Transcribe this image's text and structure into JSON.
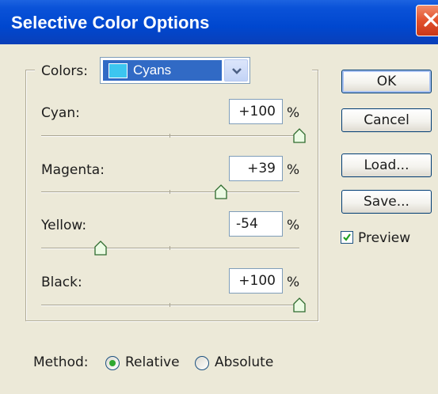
{
  "dialog": {
    "title": "Selective Color Options"
  },
  "colors": {
    "label": "Colors:",
    "selected": "Cyans",
    "swatch_color": "#3cc6f0"
  },
  "channels": [
    {
      "label": "Cyan:",
      "value": "+100",
      "unit": "%",
      "slider_fraction": 1.0
    },
    {
      "label": "Magenta:",
      "value": "+39",
      "unit": "%",
      "slider_fraction": 0.695
    },
    {
      "label": "Yellow:",
      "value": "-54",
      "unit": "%",
      "slider_fraction": 0.23
    },
    {
      "label": "Black:",
      "value": "+100",
      "unit": "%",
      "slider_fraction": 1.0
    }
  ],
  "buttons": {
    "ok": "OK",
    "cancel": "Cancel",
    "load": "Load...",
    "save": "Save..."
  },
  "preview": {
    "label": "Preview",
    "checked": true
  },
  "method": {
    "label": "Method:",
    "options": [
      "Relative",
      "Absolute"
    ],
    "selected": "Relative"
  }
}
